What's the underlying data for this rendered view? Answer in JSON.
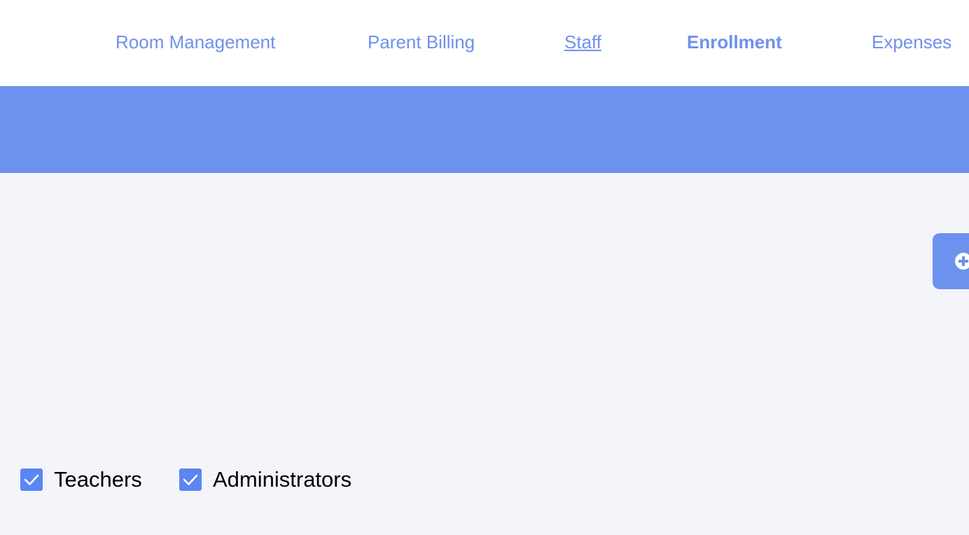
{
  "nav": {
    "items": [
      {
        "label": "Room Management"
      },
      {
        "label": "Parent Billing"
      },
      {
        "label": "Staff",
        "state": "underlined"
      },
      {
        "label": "Enrollment",
        "state": "active"
      },
      {
        "label": "Expenses"
      }
    ]
  },
  "add_button": {
    "icon": "plus-circle-icon"
  },
  "filters": [
    {
      "label": "Teachers",
      "checked": true
    },
    {
      "label": "Administrators",
      "checked": true
    }
  ],
  "colors": {
    "accent": "#6d91ee",
    "nav_text": "#6f90ec",
    "checkbox": "#5b86f0",
    "background": "#f4f5fa"
  }
}
